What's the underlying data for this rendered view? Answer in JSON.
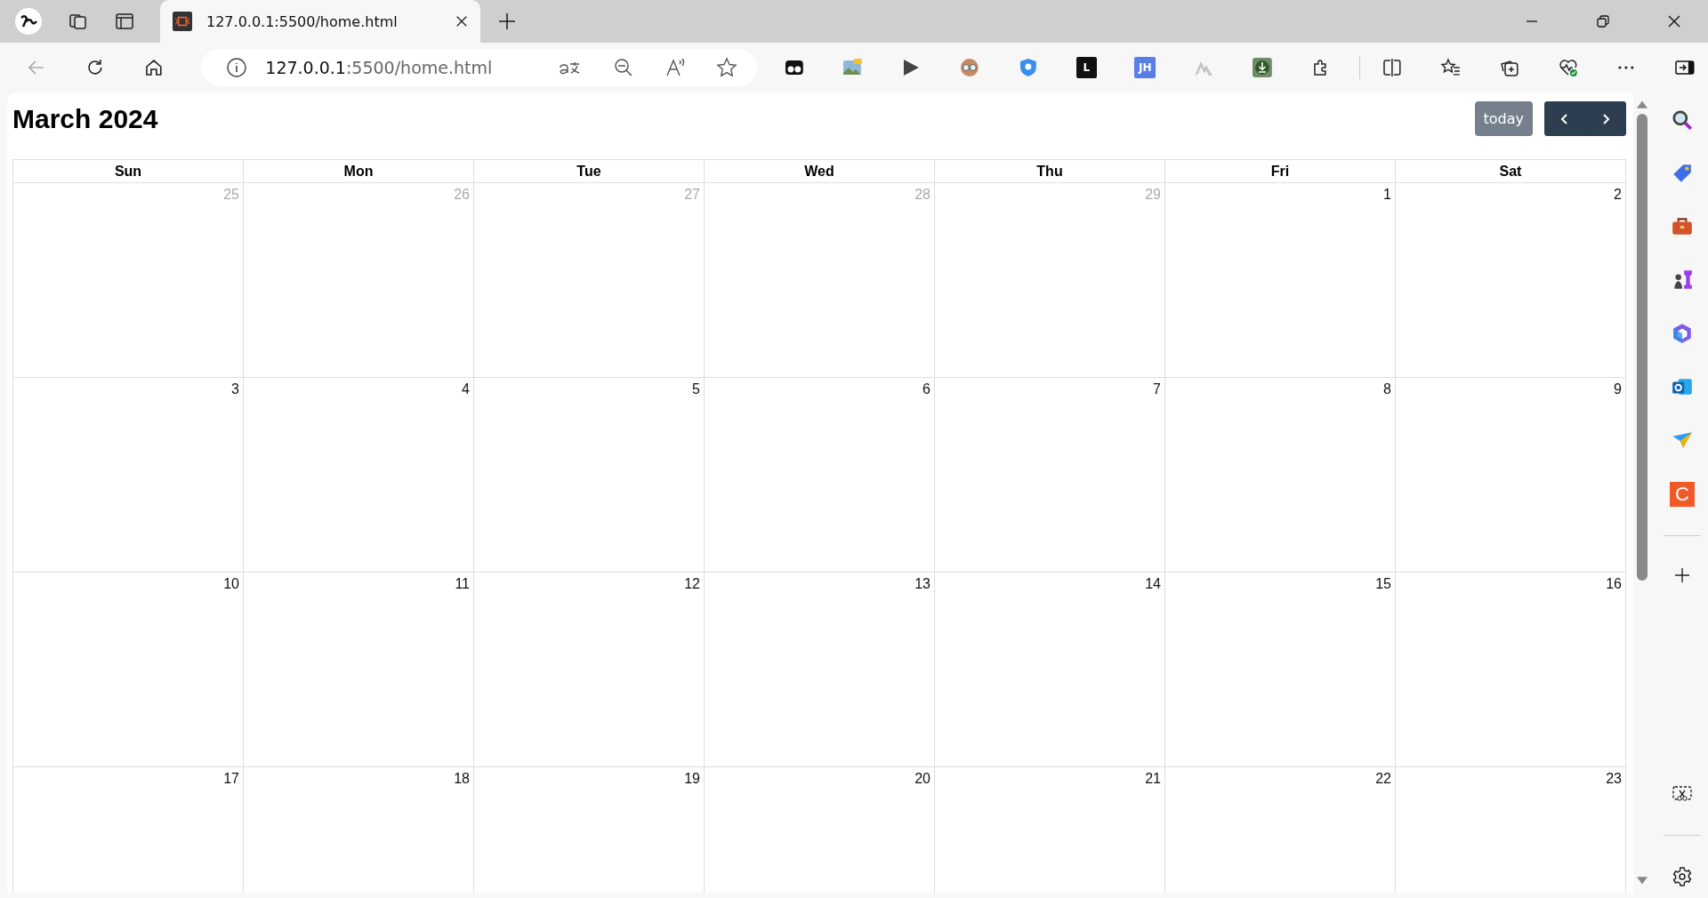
{
  "browser": {
    "tab": {
      "title": "127.0.0.1:5500/home.html",
      "selected": true
    },
    "address": {
      "host": "127.0.0.1",
      "path": ":5500/home.html"
    },
    "extensions": [
      {
        "kind": "mask"
      },
      {
        "kind": "photo"
      },
      {
        "kind": "play"
      },
      {
        "kind": "face"
      },
      {
        "kind": "shield"
      },
      {
        "kind": "tile",
        "label": "L"
      },
      {
        "kind": "tile-blue",
        "label": "JH"
      },
      {
        "kind": "mountain"
      },
      {
        "kind": "download"
      }
    ],
    "sidebar": [
      {
        "kind": "search"
      },
      {
        "kind": "tag"
      },
      {
        "kind": "toolbox"
      },
      {
        "kind": "chess"
      },
      {
        "kind": "copilot"
      },
      {
        "kind": "outlook"
      },
      {
        "kind": "send"
      },
      {
        "kind": "c-app",
        "label": "C"
      }
    ]
  },
  "calendar": {
    "title": "March 2024",
    "today_button": {
      "label": "today",
      "disabled": true
    },
    "weekdays": [
      "Sun",
      "Mon",
      "Tue",
      "Wed",
      "Thu",
      "Fri",
      "Sat"
    ],
    "weeks": [
      [
        {
          "day": "25",
          "other_month": true
        },
        {
          "day": "26",
          "other_month": true
        },
        {
          "day": "27",
          "other_month": true
        },
        {
          "day": "28",
          "other_month": true
        },
        {
          "day": "29",
          "other_month": true
        },
        {
          "day": "1",
          "other_month": false
        },
        {
          "day": "2",
          "other_month": false
        }
      ],
      [
        {
          "day": "3",
          "other_month": false
        },
        {
          "day": "4",
          "other_month": false
        },
        {
          "day": "5",
          "other_month": false
        },
        {
          "day": "6",
          "other_month": false
        },
        {
          "day": "7",
          "other_month": false
        },
        {
          "day": "8",
          "other_month": false
        },
        {
          "day": "9",
          "other_month": false
        }
      ],
      [
        {
          "day": "10",
          "other_month": false
        },
        {
          "day": "11",
          "other_month": false
        },
        {
          "day": "12",
          "other_month": false
        },
        {
          "day": "13",
          "other_month": false
        },
        {
          "day": "14",
          "other_month": false
        },
        {
          "day": "15",
          "other_month": false
        },
        {
          "day": "16",
          "other_month": false
        }
      ],
      [
        {
          "day": "17",
          "other_month": false
        },
        {
          "day": "18",
          "other_month": false
        },
        {
          "day": "19",
          "other_month": false
        },
        {
          "day": "20",
          "other_month": false
        },
        {
          "day": "21",
          "other_month": false
        },
        {
          "day": "22",
          "other_month": false
        },
        {
          "day": "23",
          "other_month": false
        }
      ]
    ]
  }
}
